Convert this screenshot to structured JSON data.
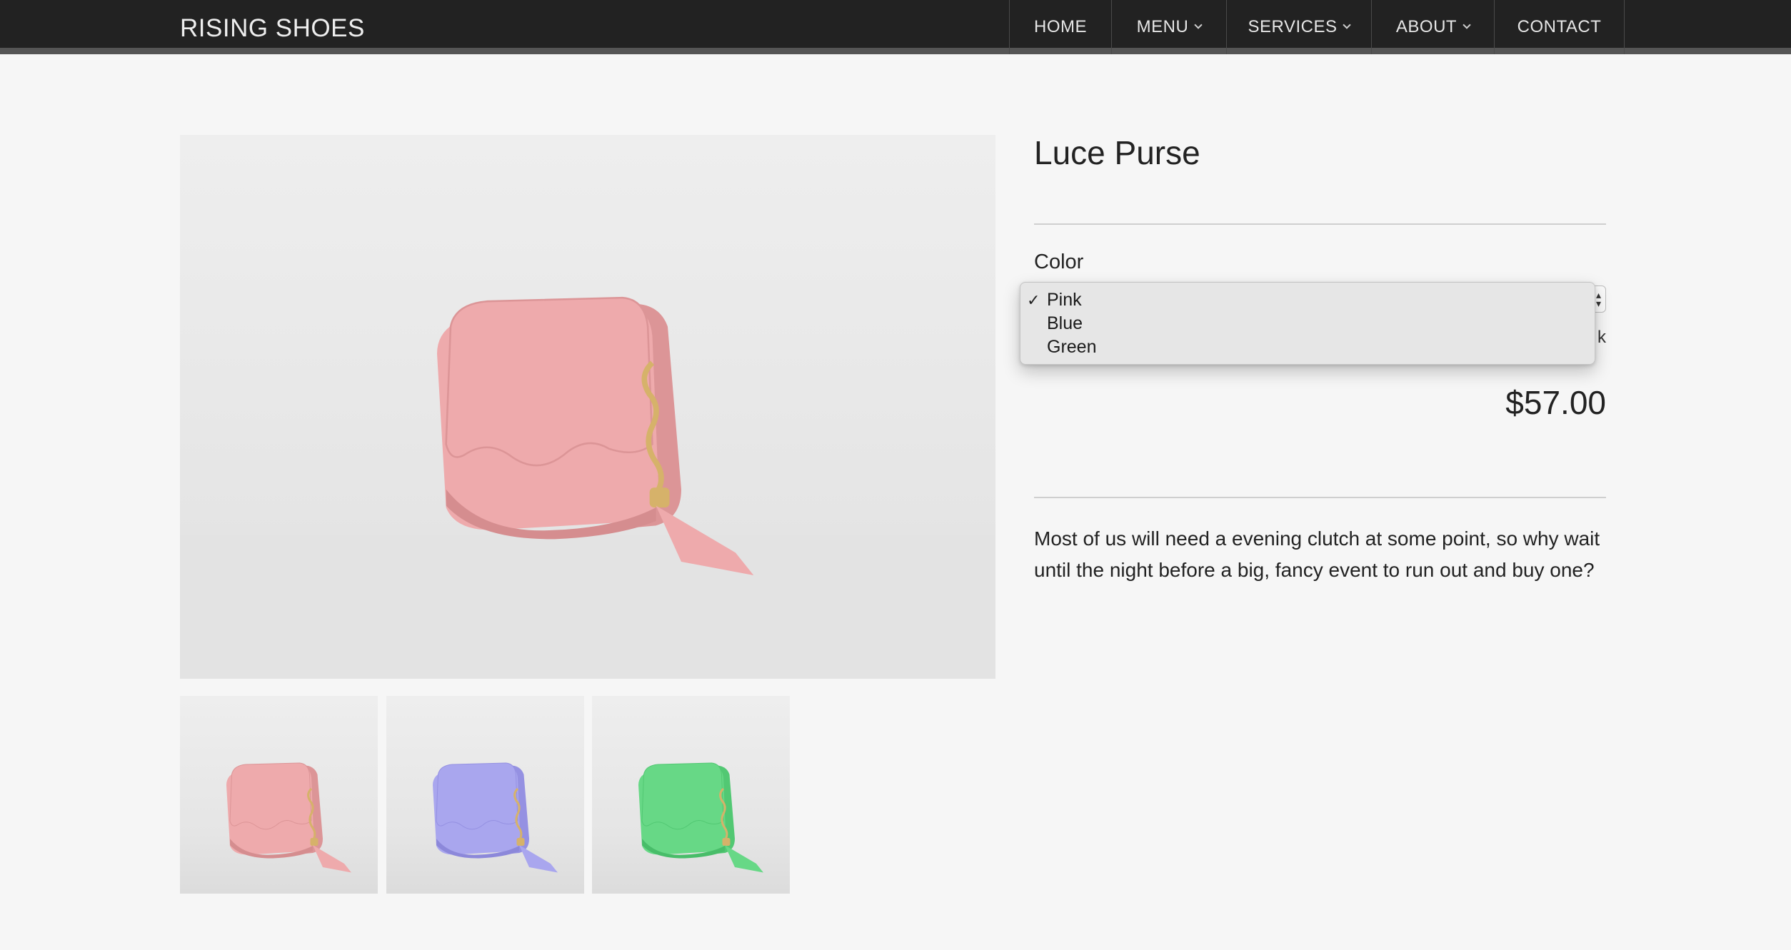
{
  "header": {
    "brand": "RISING SHOES",
    "nav": [
      {
        "label": "HOME",
        "has_dropdown": false
      },
      {
        "label": "MENU",
        "has_dropdown": true
      },
      {
        "label": "SERVICES",
        "has_dropdown": true
      },
      {
        "label": "ABOUT",
        "has_dropdown": true
      },
      {
        "label": "CONTACT",
        "has_dropdown": false
      }
    ]
  },
  "product": {
    "title": "Luce Purse",
    "color_label": "Color",
    "selected_color": "Pink",
    "color_options": [
      {
        "label": "Pink",
        "checked": true,
        "swatch": "#eeaaac"
      },
      {
        "label": "Blue",
        "checked": false,
        "swatch": "#a9a6ee"
      },
      {
        "label": "Green",
        "checked": false,
        "swatch": "#67d886"
      }
    ],
    "stock_text_visible": "k",
    "price": "$57.00",
    "description": "Most of us will need a evening clutch at some point, so why wait until the night before a big, fancy event to run out and buy one?"
  },
  "icons": {
    "checkmark": "check-icon",
    "dropdown_chevron": "chevron-down-icon",
    "select_arrows": "up-down-arrows-icon"
  },
  "colors": {
    "topbar": "#222222",
    "topbar_border": "#555555",
    "page_background": "#f6f6f6",
    "purse_pink": "#eeaaac",
    "purse_blue": "#a9a6ee",
    "purse_green": "#67d886",
    "tassel_gold": "#d6b26a"
  }
}
